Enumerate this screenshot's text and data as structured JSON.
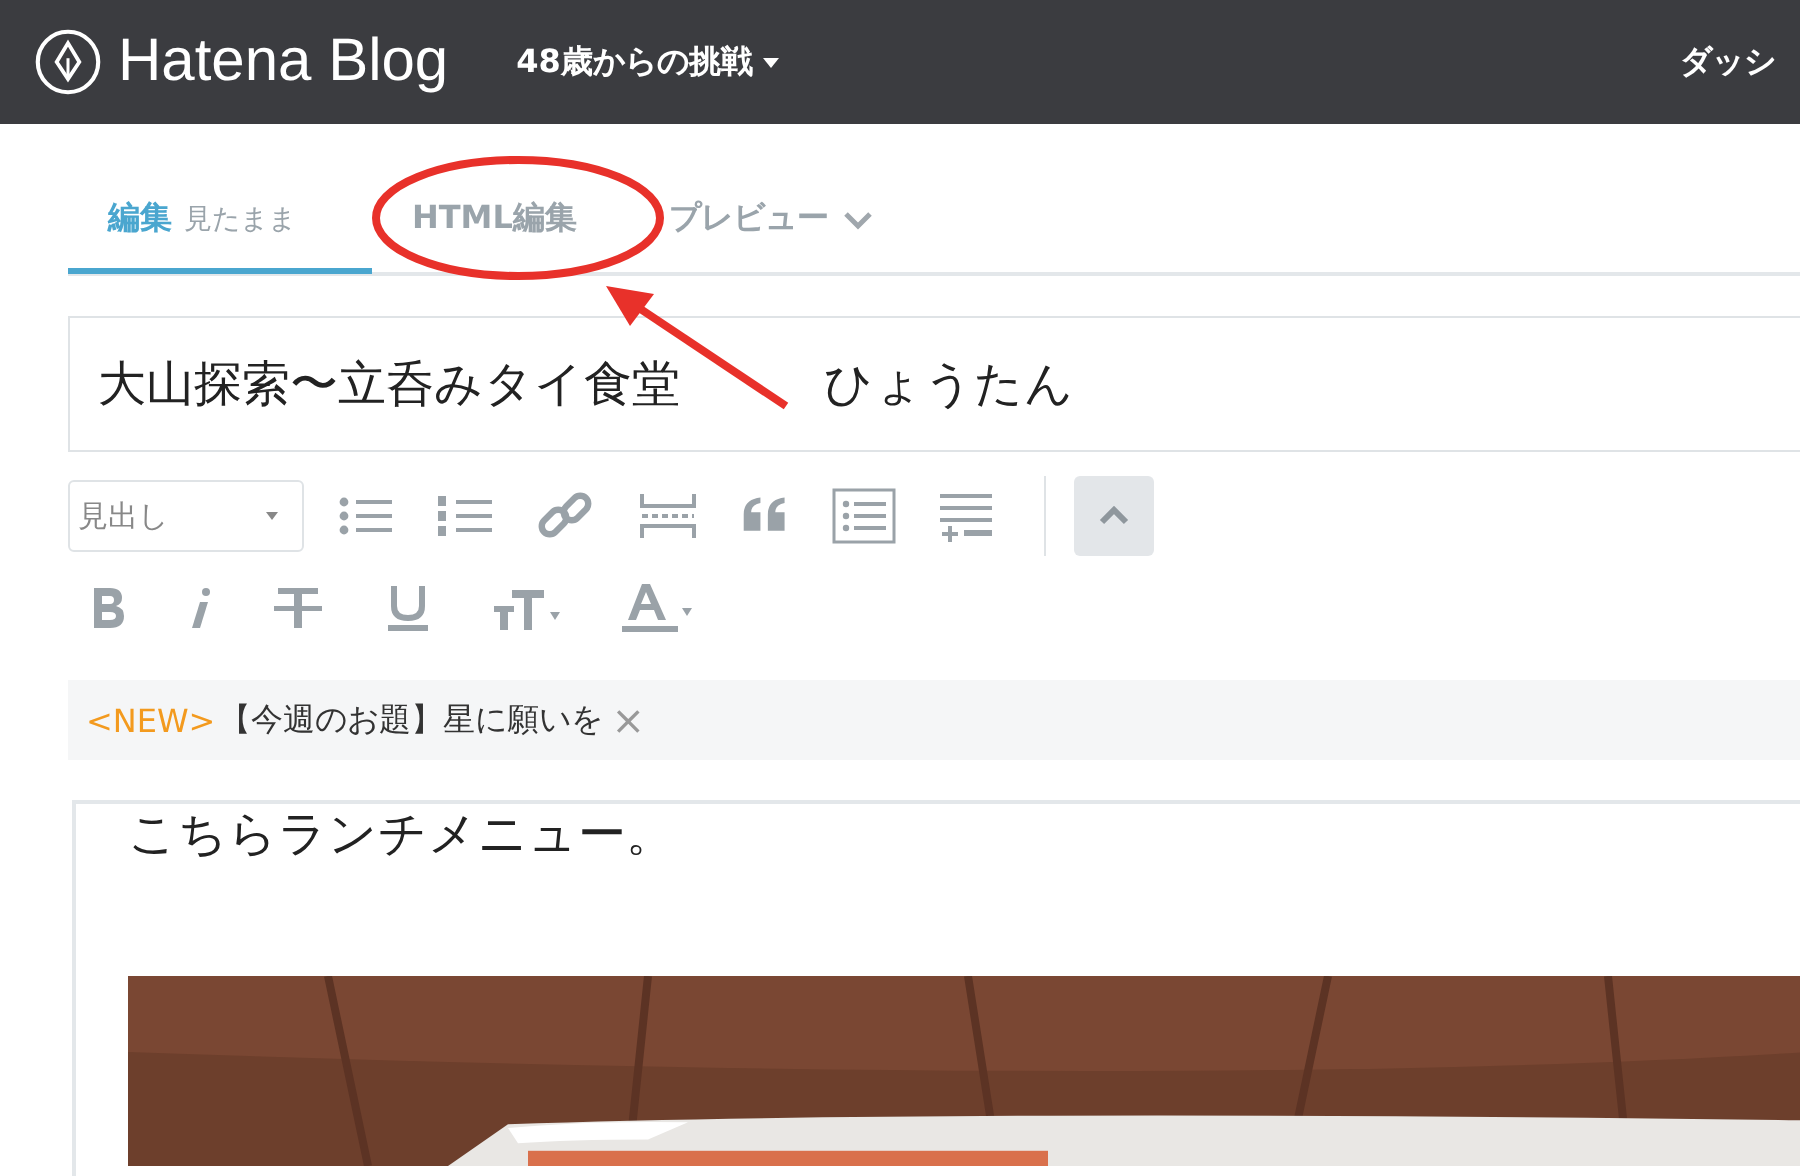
{
  "header": {
    "logo": "Hatena Blog",
    "blog_title": "48歳からの挑戦",
    "menu": "ダッシ"
  },
  "tabs": [
    {
      "label": "編集",
      "sub": "見たまま",
      "selected": true
    },
    {
      "label": "HTML編集",
      "selected": false
    },
    {
      "label": "プレビュー",
      "selected": false
    }
  ],
  "title_field": {
    "value": "大山探索〜立呑みタイ食堂　　　ひょうたん"
  },
  "format_select": {
    "value": "見出し"
  },
  "notice": {
    "tag": "<NEW>",
    "text": "【今週のお題】星に願いを",
    "close": "×"
  },
  "body": {
    "text": "こちらランチメニュー。"
  }
}
